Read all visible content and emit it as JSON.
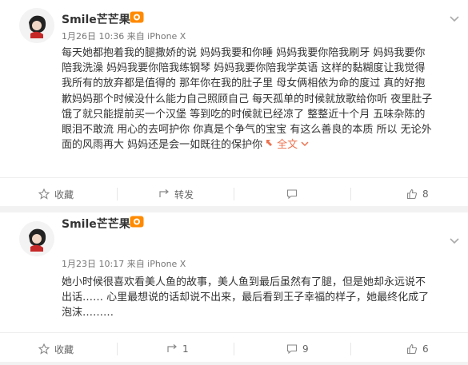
{
  "posts": [
    {
      "username": "Smile芒芒果",
      "meta": "1月26日 10:36 来自 iPhone X",
      "body_lines": [
        "每天她都抱着我的腿撒娇的说 妈妈我要和你睡 妈妈我要你陪我刷牙 妈妈我要你",
        "陪我洗澡 妈妈我要你陪我练钢琴 妈妈我要你陪我学英语 这样的黏糊度让我觉得",
        "我所有的放弃都是值得的 那年你在我的肚子里 母女俩相依为命的度过 真的好抱",
        "歉妈妈那个时候没什么能力自己照顾自己 每天孤单的时候就放歌给你听 夜里肚子",
        "饿了就只能提前买一个汉堡 等到吃的时候就已经凉了 整整近十个月 五味杂陈的",
        "眼泪不敢流 用心的去呵护你 你真是个争气的宝宝 有这么善良的本质 所以 无论外",
        "面的风雨再大 妈妈还是会一如既往的保护你"
      ],
      "more_label": "全文",
      "actions": {
        "favorite": "收藏",
        "repost": "转发",
        "comment_count": "",
        "like_count": "8"
      }
    },
    {
      "username": "Smile芒芒果",
      "meta": "1月23日 10:17 来自 iPhone X",
      "body_lines": [
        "她小时候很喜欢看美人鱼的故事，美人鱼到最后虽然有了腿，但是她却永远说不",
        "出话…… 心里最想说的话却说不出来，最后看到王子幸福的样子，她最终化成了",
        "泡沫………"
      ],
      "more_label": "",
      "actions": {
        "favorite": "收藏",
        "repost": "1",
        "comment_count": "9",
        "like_count": "6"
      }
    }
  ]
}
